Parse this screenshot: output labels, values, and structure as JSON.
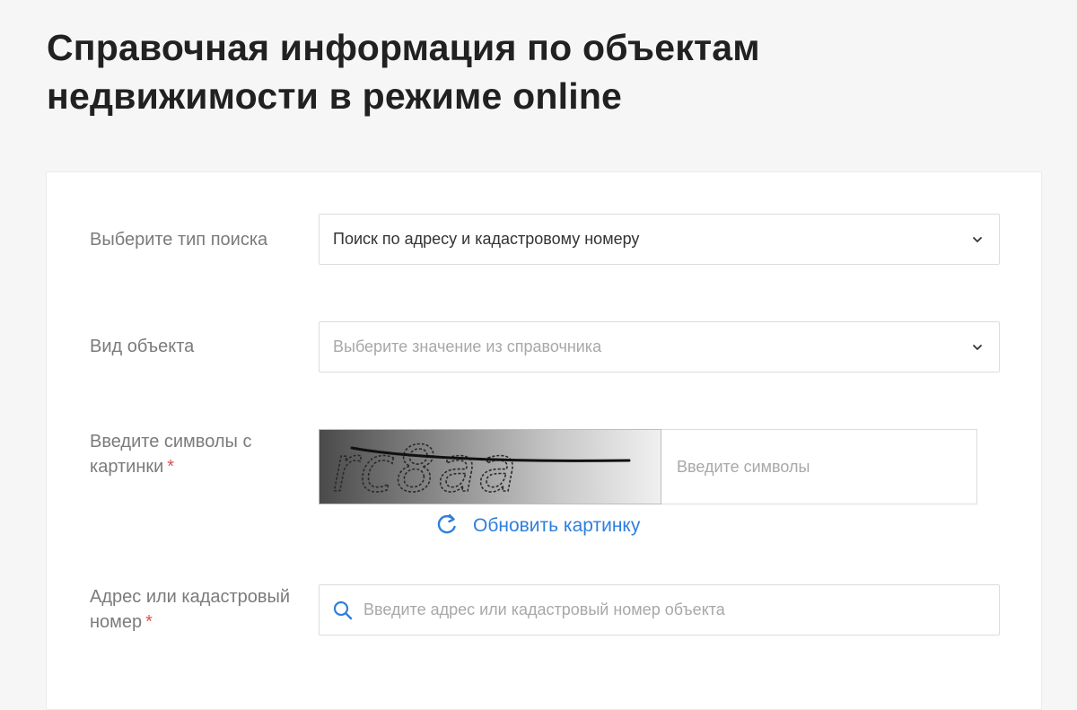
{
  "page": {
    "title": "Справочная информация по объектам недвижимости в режиме online"
  },
  "form": {
    "search_type": {
      "label": "Выберите тип поиска",
      "value": "Поиск по адресу и кадастровому номеру"
    },
    "object_type": {
      "label": "Вид объекта",
      "placeholder": "Выберите значение из справочника"
    },
    "captcha": {
      "label": "Введите символы с картинки",
      "required_mark": "*",
      "image_text": "rc8aa",
      "input_placeholder": "Введите символы",
      "refresh_label": "Обновить картинку"
    },
    "address": {
      "label": "Адрес или кадастровый номер",
      "required_mark": "*",
      "placeholder": "Введите адрес или кадастровый номер объекта"
    }
  },
  "colors": {
    "link": "#2f7fdb",
    "required": "#d9534f",
    "label": "#7b7b7b",
    "placeholder": "#a8a8a8"
  },
  "icons": [
    "chevron-down-icon",
    "refresh-icon",
    "search-icon"
  ]
}
